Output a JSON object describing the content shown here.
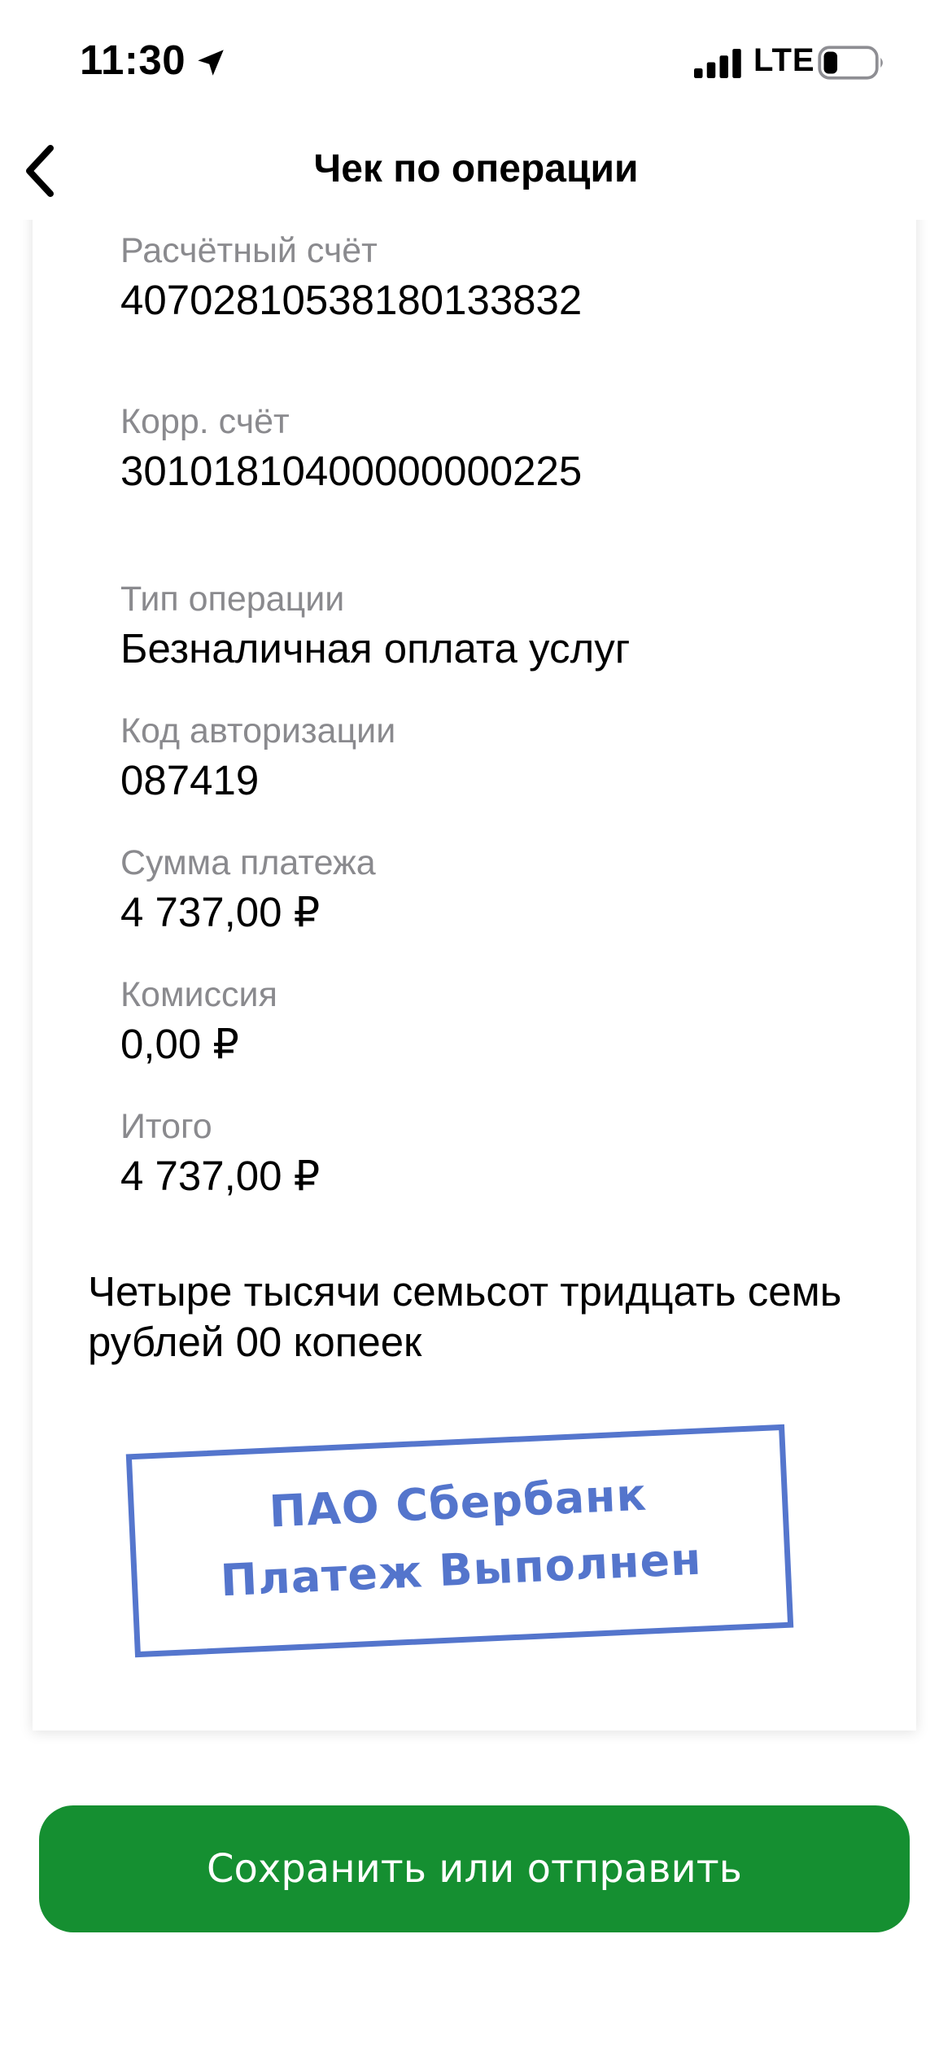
{
  "status_bar": {
    "time": "11:30",
    "network": "LTE",
    "icons": [
      "location-arrow-icon",
      "signal-icon",
      "battery-icon"
    ]
  },
  "header": {
    "title": "Чек по операции",
    "back_icon": "chevron-left-icon"
  },
  "receipt": {
    "settlement_account": {
      "label": "Расчётный счёт",
      "value": "40702810538180133832"
    },
    "correspondent_account": {
      "label": "Корр. счёт",
      "value": "30101810400000000225"
    },
    "operation_type": {
      "label": "Тип операции",
      "value": "Безналичная оплата услуг"
    },
    "auth_code": {
      "label": "Код авторизации",
      "value": "087419"
    },
    "payment_amount": {
      "label": "Сумма платежа",
      "value": "4 737,00 ₽"
    },
    "commission": {
      "label": "Комиссия",
      "value": "0,00 ₽"
    },
    "total": {
      "label": "Итого",
      "value": "4 737,00 ₽"
    },
    "amount_in_words": "Четыре тысячи семьсот тридцать семь рублей 00 копеек",
    "stamp": {
      "line1": "ПАО Сбербанк",
      "line2": "Платеж Выполнен",
      "color": "#3d63c6"
    }
  },
  "actions": {
    "save_label": "Сохранить или отправить",
    "color": "#158f31"
  }
}
